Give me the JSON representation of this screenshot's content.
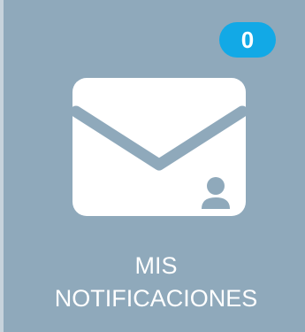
{
  "tile": {
    "badge_count": "0",
    "label_line1": "MIS",
    "label_line2": "NOTIFICACIONES",
    "icon": "envelope-user-icon"
  },
  "colors": {
    "tile_background": "#8fa9bb",
    "badge_background": "#12a9e6",
    "text": "#ffffff"
  }
}
